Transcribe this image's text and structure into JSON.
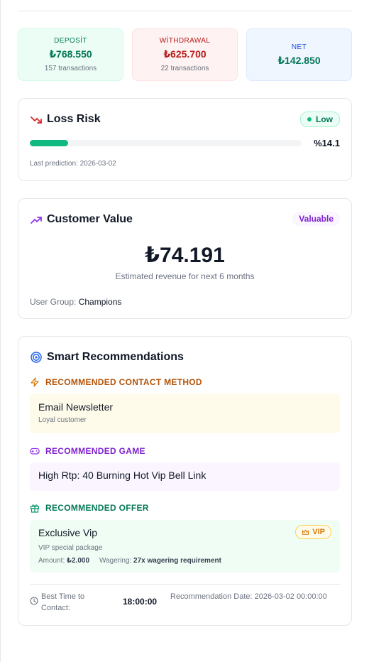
{
  "stats": {
    "deposit": {
      "label": "DEPOSİT",
      "value": "₺768.550",
      "sub": "157 transactions"
    },
    "withdrawal": {
      "label": "WİTHDRAWAL",
      "value": "₺625.700",
      "sub": "22 transactions"
    },
    "net": {
      "label": "NET",
      "value": "₺142.850"
    }
  },
  "risk": {
    "title": "Loss Risk",
    "badge": "Low",
    "percent_label": "%14.1",
    "percent": 14.1,
    "last_prediction": "Last prediction: 2026-03-02"
  },
  "value": {
    "title": "Customer Value",
    "badge": "Valuable",
    "amount": "₺74.191",
    "estimate": "Estimated revenue for next 6 months",
    "group_label": "User Group: ",
    "group_value": "Champions"
  },
  "recs": {
    "title": "Smart Recommendations",
    "contact": {
      "heading": "RECOMMENDED CONTACT METHOD",
      "title": "Email Newsletter",
      "sub": "Loyal customer"
    },
    "game": {
      "heading": "RECOMMENDED GAME",
      "title": "High Rtp: 40 Burning Hot Vip Bell Link"
    },
    "offer": {
      "heading": "RECOMMENDED OFFER",
      "title": "Exclusive Vip",
      "badge": "VIP",
      "sub": "VIP special package",
      "amount_label": "Amount:",
      "amount_value": "₺2.000",
      "wager_label": "Wagering:",
      "wager_value": "27x wagering requirement"
    },
    "best_time_label": "Best Time to Contact:",
    "best_time_value": "18:00:00",
    "rec_date": "Recommendation Date: 2026-03-02 00:00:00"
  },
  "colors": {
    "green": "#10b981",
    "red": "#dc2626",
    "purple": "#7e22ce",
    "blue": "#1d4ed8",
    "amber": "#d97706"
  }
}
